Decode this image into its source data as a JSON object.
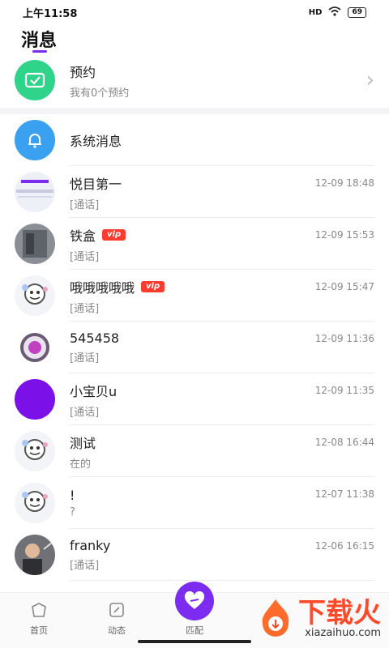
{
  "status": {
    "time": "上午11:58",
    "signal": "HD",
    "battery": "69"
  },
  "title": "消息",
  "reservation": {
    "title": "预约",
    "subtitle": "我有0个预约"
  },
  "system": {
    "title": "系统消息"
  },
  "conversations": [
    {
      "name": "悦目第一",
      "preview": "[通话]",
      "time": "12-09 18:48",
      "vip": ""
    },
    {
      "name": "铁盒",
      "preview": "[通话]",
      "time": "12-09 15:53",
      "vip": "vip"
    },
    {
      "name": "哦哦哦哦哦",
      "preview": "[通话]",
      "time": "12-09 15:47",
      "vip": "vip"
    },
    {
      "name": "545458",
      "preview": "[通话]",
      "time": "12-09 11:36",
      "vip": ""
    },
    {
      "name": "小宝贝u",
      "preview": "[通话]",
      "time": "12-09 11:35",
      "vip": ""
    },
    {
      "name": "测试",
      "preview": "在的",
      "time": "12-08 16:44",
      "vip": ""
    },
    {
      "name": "!",
      "preview": "?",
      "time": "12-07 11:38",
      "vip": ""
    },
    {
      "name": "franky",
      "preview": "[通话]",
      "time": "12-06 16:15",
      "vip": ""
    }
  ],
  "nav": {
    "home": "首页",
    "moments": "动态",
    "match": "匹配"
  },
  "watermark": {
    "main": "下载火",
    "sub": "xiazaihuo.com"
  },
  "colors": {
    "accent": "#7b2cf0",
    "vip": "#ff3b30",
    "reserve_icon": "#2fd48a",
    "system_icon": "#3aa0f0"
  }
}
